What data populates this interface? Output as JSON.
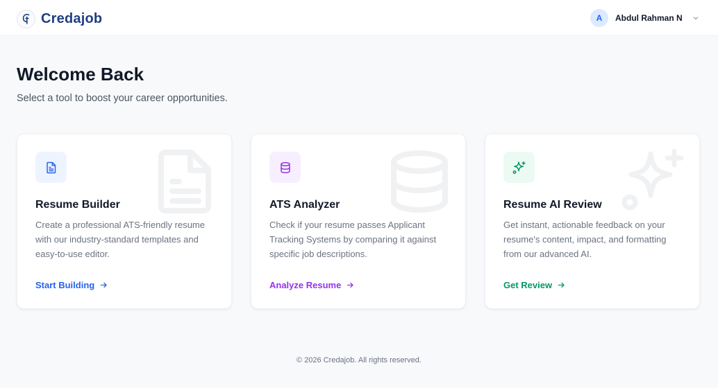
{
  "header": {
    "brand_name": "Credajob",
    "logo_icon": "credajob-logo-icon",
    "user": {
      "avatar_initial": "A",
      "name": "Abdul Rahman N",
      "menu_icon": "chevron-down-icon"
    }
  },
  "main": {
    "title": "Welcome Back",
    "subtitle": "Select a tool to boost your career opportunities."
  },
  "cards": [
    {
      "title": "Resume Builder",
      "description": "Create a professional ATS-friendly resume with our industry-standard templates and easy-to-use editor.",
      "link_label": "Start Building",
      "icon": "document-icon",
      "accent": "#2563eb",
      "icon_bg": "#eef4ff"
    },
    {
      "title": "ATS Analyzer",
      "description": "Check if your resume passes Applicant Tracking Systems by comparing it against specific job descriptions.",
      "link_label": "Analyze Resume",
      "icon": "database-icon",
      "accent": "#9333ea",
      "icon_bg": "#f7efff"
    },
    {
      "title": "Resume AI Review",
      "description": "Get instant, actionable feedback on your resume's content, impact, and formatting from our advanced AI.",
      "link_label": "Get Review",
      "icon": "sparkles-icon",
      "accent": "#059669",
      "icon_bg": "#ebfbf3"
    }
  ],
  "footer": {
    "copyright": "© 2026 Credajob. All rights reserved."
  }
}
